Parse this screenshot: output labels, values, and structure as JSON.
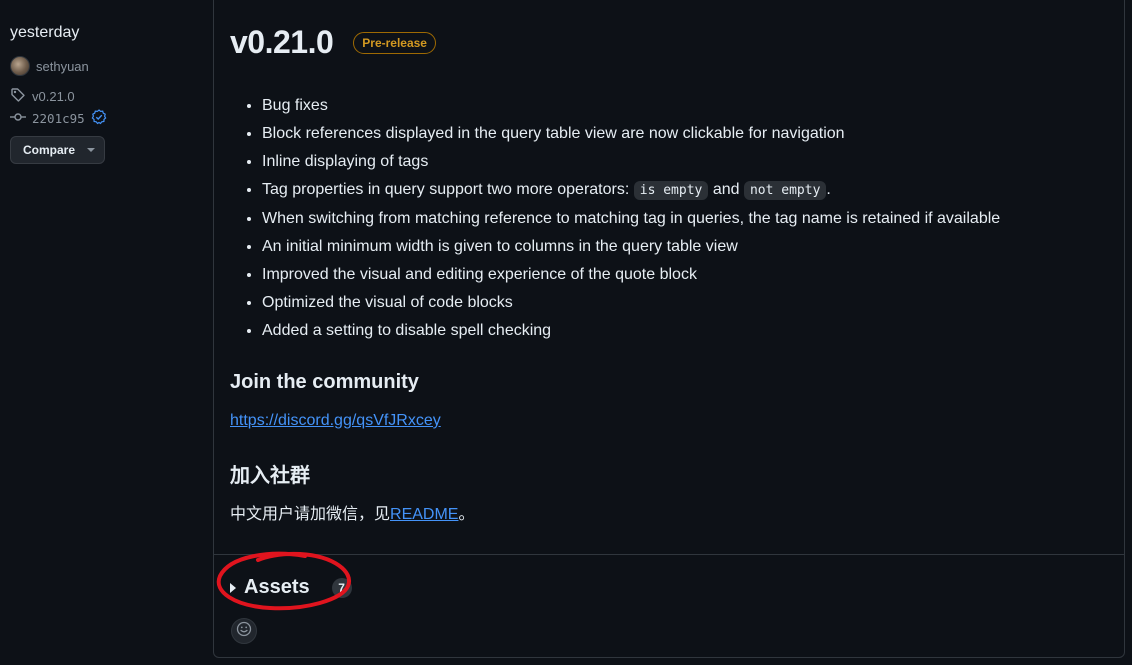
{
  "sidebar": {
    "date": "yesterday",
    "author": "sethyuan",
    "tag": "v0.21.0",
    "commit": "2201c95",
    "compare_label": "Compare"
  },
  "release": {
    "title": "v0.21.0",
    "badge": "Pre-release",
    "bullets": [
      "Bug fixes",
      "Block references displayed in the query table view are now clickable for navigation",
      "Inline displaying of tags"
    ],
    "tag_ops": {
      "prefix": "Tag properties in query support two more operators: ",
      "op1": "is empty",
      "joiner": " and ",
      "op2": "not empty",
      "suffix": "."
    },
    "bullets_after": [
      "When switching from matching reference to matching tag in queries, the tag name is retained if available",
      "An initial minimum width is given to columns in the query table view",
      "Improved the visual and editing experience of the quote block",
      "Optimized the visual of code blocks",
      "Added a setting to disable spell checking"
    ],
    "community_heading": "Join the community",
    "community_link": "https://discord.gg/qsVfJRxcey",
    "cn_heading": "加入社群",
    "cn_text": "中文用户请加微信，见",
    "cn_link": "README",
    "cn_end": "。"
  },
  "assets": {
    "label": "Assets",
    "count": "7"
  },
  "colors": {
    "accent_link": "#4493f8",
    "prerelease": "#d29922",
    "annotation": "#e0141e"
  }
}
